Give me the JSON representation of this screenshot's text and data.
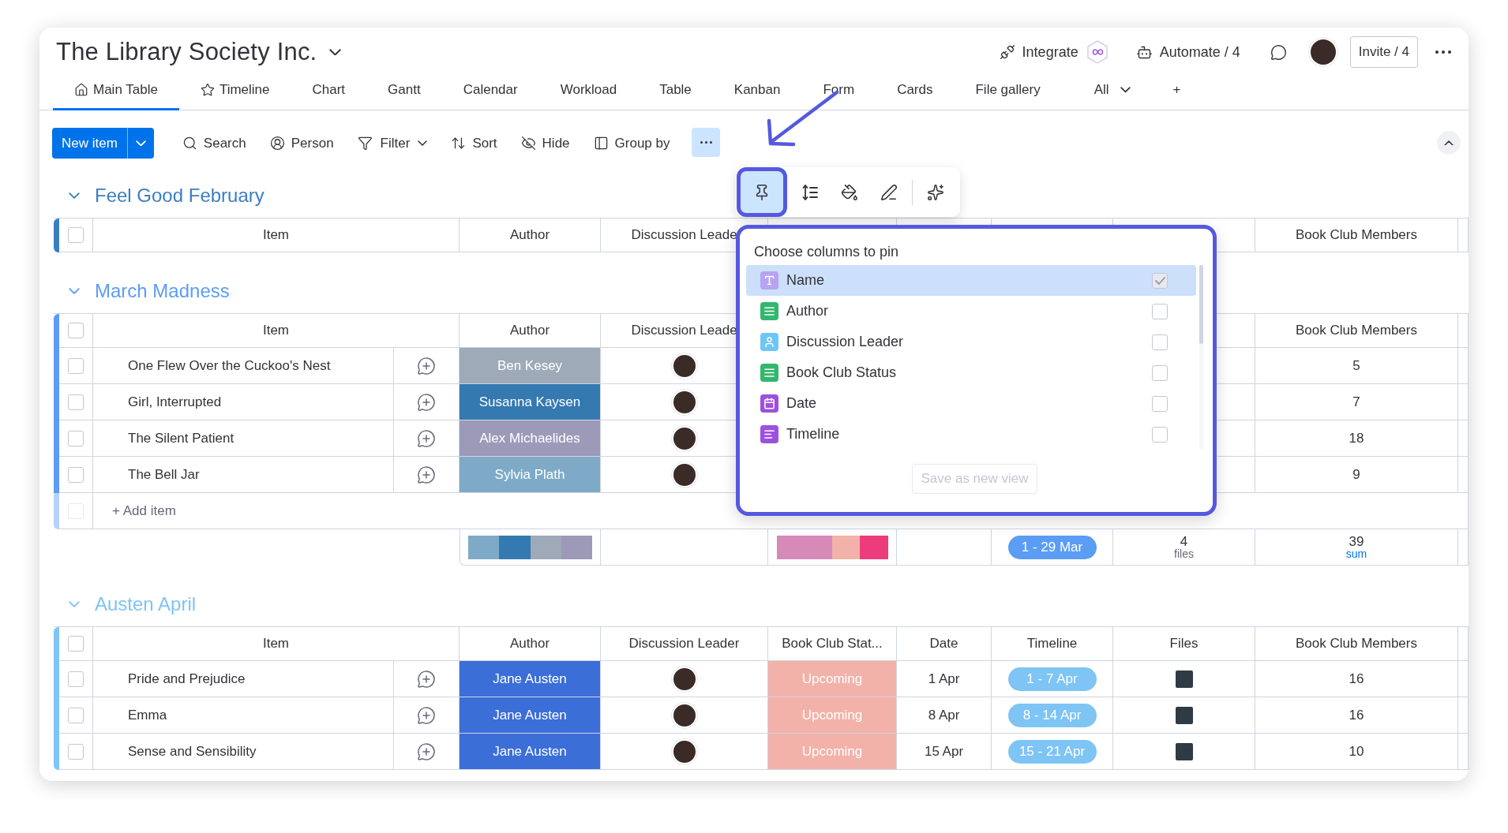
{
  "board": {
    "title": "The Library Society Inc."
  },
  "header_actions": {
    "integrate": "Integrate",
    "automate": "Automate / 4",
    "invite": "Invite / 4"
  },
  "tabs": [
    {
      "kind": "main",
      "label": "Main Table",
      "selected": true
    },
    {
      "kind": "favorite",
      "label": "Timeline",
      "selected": false
    },
    {
      "kind": "view",
      "label": "Chart",
      "selected": false
    },
    {
      "kind": "view",
      "label": "Gantt",
      "selected": false
    },
    {
      "kind": "view",
      "label": "Calendar",
      "selected": false
    },
    {
      "kind": "view",
      "label": "Workload",
      "selected": false
    },
    {
      "kind": "view",
      "label": "Table",
      "selected": false
    },
    {
      "kind": "view",
      "label": "Kanban",
      "selected": false
    },
    {
      "kind": "view",
      "label": "Form",
      "selected": false
    },
    {
      "kind": "view",
      "label": "Cards",
      "selected": false
    },
    {
      "kind": "view",
      "label": "File gallery",
      "selected": false
    },
    {
      "kind": "menu",
      "label": "All",
      "selected": false
    },
    {
      "kind": "add",
      "label": "+",
      "selected": false
    }
  ],
  "toolbar": {
    "new_item": "New item",
    "tools": [
      {
        "kind": "search",
        "label": "Search"
      },
      {
        "kind": "person",
        "label": "Person"
      },
      {
        "kind": "filter",
        "label": "Filter"
      },
      {
        "kind": "sort",
        "label": "Sort"
      },
      {
        "kind": "hide",
        "label": "Hide"
      },
      {
        "kind": "group",
        "label": "Group by"
      }
    ],
    "more_selected": true
  },
  "mini_toolbar": [
    {
      "kind": "pin",
      "selected": true
    },
    {
      "kind": "row_height",
      "selected": false
    },
    {
      "kind": "color",
      "selected": false
    },
    {
      "kind": "edit",
      "selected": false
    },
    {
      "kind": "ai",
      "selected": false
    }
  ],
  "pin_menu": {
    "title": "Choose columns to pin",
    "columns": [
      {
        "kind": "text",
        "label": "Name",
        "selected": true,
        "checked": true
      },
      {
        "kind": "status",
        "label": "Author",
        "selected": false,
        "checked": false
      },
      {
        "kind": "people",
        "label": "Discussion Leader",
        "selected": false,
        "checked": false
      },
      {
        "kind": "status",
        "label": "Book Club Status",
        "selected": false,
        "checked": false
      },
      {
        "kind": "date",
        "label": "Date",
        "selected": false,
        "checked": false
      },
      {
        "kind": "timeline",
        "label": "Timeline",
        "selected": false,
        "checked": false
      }
    ],
    "save_button": {
      "label": "Save as new view",
      "disabled": true
    }
  },
  "groups": [
    {
      "title": "Feel Good February",
      "color": "#3a7ec2",
      "all_checked": false,
      "columns": [
        {
          "kind": "item",
          "label": "Item"
        },
        {
          "kind": "author",
          "label": "Author"
        },
        {
          "kind": "leader",
          "label": "Discussion Leade"
        },
        {
          "kind": "members",
          "label": "Book Club Members"
        }
      ]
    },
    {
      "title": "March Madness",
      "color": "#5b9cf5",
      "all_checked": false,
      "columns": [
        {
          "kind": "item",
          "label": "Item"
        },
        {
          "kind": "author",
          "label": "Author"
        },
        {
          "kind": "leader",
          "label": "Discussion Leade"
        },
        {
          "kind": "members",
          "label": "Book Club Members"
        }
      ],
      "rows": [
        {
          "name": "One Flew Over the Cuckoo's Nest",
          "checked": false,
          "author": {
            "name": "Ben Kesey",
            "color": "#9eaab8"
          },
          "leader_avatar": true,
          "members": "5"
        },
        {
          "name": "Girl, Interrupted",
          "checked": false,
          "author": {
            "name": "Susanna Kaysen",
            "color": "#3479b0"
          },
          "leader_avatar": true,
          "members": "7"
        },
        {
          "name": "The Silent Patient",
          "checked": false,
          "author": {
            "name": "Alex Michaelides",
            "color": "#9d99b9"
          },
          "leader_avatar": true,
          "members": "18"
        },
        {
          "name": "The Bell Jar",
          "checked": false,
          "author": {
            "name": "Sylvia Plath",
            "color": "#7eaac8"
          },
          "leader_avatar": true,
          "members": "9"
        }
      ],
      "add_item": {
        "label": "+ Add item",
        "checked": false
      },
      "summary": {
        "author_segments": [
          {
            "color": "#7eaac8"
          },
          {
            "color": "#3479b0"
          },
          {
            "color": "#9eaab8"
          },
          {
            "color": "#9d99b9"
          }
        ],
        "status_segments": [
          {
            "color": "#d58ab8"
          },
          {
            "color": "#d58ab8"
          },
          {
            "color": "#f2b2aa"
          },
          {
            "color": "#ec3c7c"
          }
        ],
        "timeline": "1 - 29 Mar",
        "files_count": "4",
        "files_label": "files",
        "members_sum": "39",
        "members_label": "sum"
      }
    },
    {
      "title": "Austen April",
      "color": "#7ec4f5",
      "all_checked": false,
      "columns": [
        {
          "kind": "item",
          "label": "Item"
        },
        {
          "kind": "author",
          "label": "Author"
        },
        {
          "kind": "leader",
          "label": "Discussion Leader"
        },
        {
          "kind": "status",
          "label": "Book Club Stat..."
        },
        {
          "kind": "date",
          "label": "Date"
        },
        {
          "kind": "timeline",
          "label": "Timeline"
        },
        {
          "kind": "files",
          "label": "Files"
        },
        {
          "kind": "members",
          "label": "Book Club Members"
        }
      ],
      "rows": [
        {
          "name": "Pride and Prejudice",
          "checked": false,
          "author": {
            "name": "Jane Austen",
            "color": "#3c6ed8"
          },
          "leader_avatar": true,
          "status": {
            "label": "Upcoming",
            "color": "#f2b2aa"
          },
          "date": "1 Apr",
          "timeline": "1 - 7 Apr",
          "file_thumbnail": true,
          "members": "16"
        },
        {
          "name": "Emma",
          "checked": false,
          "author": {
            "name": "Jane Austen",
            "color": "#3c6ed8"
          },
          "leader_avatar": true,
          "status": {
            "label": "Upcoming",
            "color": "#f2b2aa"
          },
          "date": "8 Apr",
          "timeline": "8 - 14 Apr",
          "file_thumbnail": true,
          "members": "16"
        },
        {
          "name": "Sense and Sensibility",
          "checked": false,
          "author": {
            "name": "Jane Austen",
            "color": "#3c6ed8"
          },
          "leader_avatar": true,
          "status": {
            "label": "Upcoming",
            "color": "#f2b2aa"
          },
          "date": "15 Apr",
          "timeline": "15 - 21 Apr",
          "file_thumbnail": true,
          "members": "10"
        }
      ]
    }
  ]
}
